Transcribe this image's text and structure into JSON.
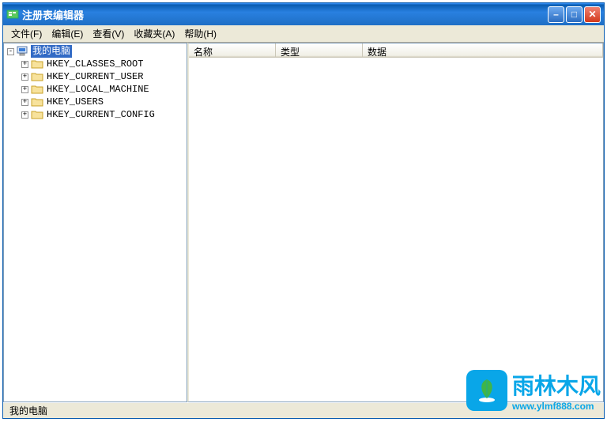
{
  "window": {
    "title": "注册表编辑器"
  },
  "menu": {
    "file": "文件(F)",
    "edit": "编辑(E)",
    "view": "查看(V)",
    "favorites": "收藏夹(A)",
    "help": "帮助(H)"
  },
  "tree": {
    "root": {
      "label": "我的电脑",
      "expanded": true
    },
    "items": [
      {
        "label": "HKEY_CLASSES_ROOT"
      },
      {
        "label": "HKEY_CURRENT_USER"
      },
      {
        "label": "HKEY_LOCAL_MACHINE"
      },
      {
        "label": "HKEY_USERS"
      },
      {
        "label": "HKEY_CURRENT_CONFIG"
      }
    ]
  },
  "columns": {
    "name": "名称",
    "type": "类型",
    "data": "数据"
  },
  "status": {
    "path": "我的电脑"
  },
  "watermark": {
    "brand": "雨林木风",
    "url": "www.ylmf888.com"
  },
  "controls": {
    "min": "–",
    "max": "□",
    "close": "✕"
  }
}
